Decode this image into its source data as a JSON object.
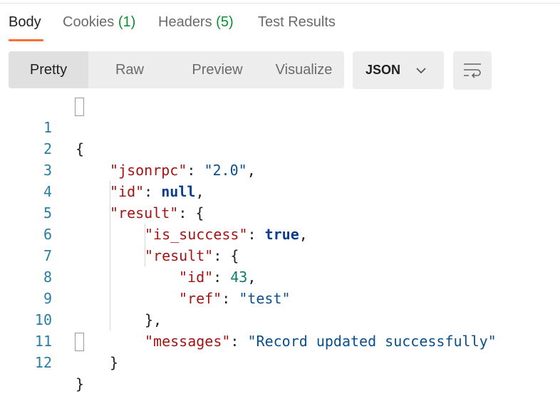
{
  "tabs": [
    {
      "label": "Body",
      "count": ""
    },
    {
      "label": "Cookies ",
      "count": "(1)"
    },
    {
      "label": "Headers ",
      "count": "(5)"
    },
    {
      "label": "Test Results",
      "count": ""
    }
  ],
  "views": [
    "Pretty",
    "Raw",
    "Preview",
    "Visualize"
  ],
  "language": "JSON",
  "icons": {
    "language_dropdown": "chevron-down-icon",
    "wrap": "wrap-lines-icon"
  },
  "colors": {
    "accent": "#ff6c37",
    "count": "#0b8f2f",
    "key": "#a31515",
    "string": "#0b4f8a",
    "number": "#0f7a73"
  },
  "line_numbers": [
    "1",
    "2",
    "3",
    "4",
    "5",
    "6",
    "7",
    "8",
    "9",
    "10",
    "11",
    "12"
  ],
  "code": {
    "l1": {
      "open": "{"
    },
    "l2": {
      "key": "\"jsonrpc\"",
      "colon": ": ",
      "value": "\"2.0\"",
      "comma": ","
    },
    "l3": {
      "key": "\"id\"",
      "colon": ": ",
      "value": "null",
      "comma": ","
    },
    "l4": {
      "key": "\"result\"",
      "colon": ": ",
      "open": "{"
    },
    "l5": {
      "key": "\"is_success\"",
      "colon": ": ",
      "value": "true",
      "comma": ","
    },
    "l6": {
      "key": "\"result\"",
      "colon": ": ",
      "open": "{"
    },
    "l7": {
      "key": "\"id\"",
      "colon": ": ",
      "value": "43",
      "comma": ","
    },
    "l8": {
      "key": "\"ref\"",
      "colon": ": ",
      "value": "\"test\""
    },
    "l9": {
      "close": "},"
    },
    "l10": {
      "key": "\"messages\"",
      "colon": ": ",
      "value": "\"Record updated successfully\""
    },
    "l11": {
      "close": "}"
    },
    "l12": {
      "close": "}"
    }
  }
}
